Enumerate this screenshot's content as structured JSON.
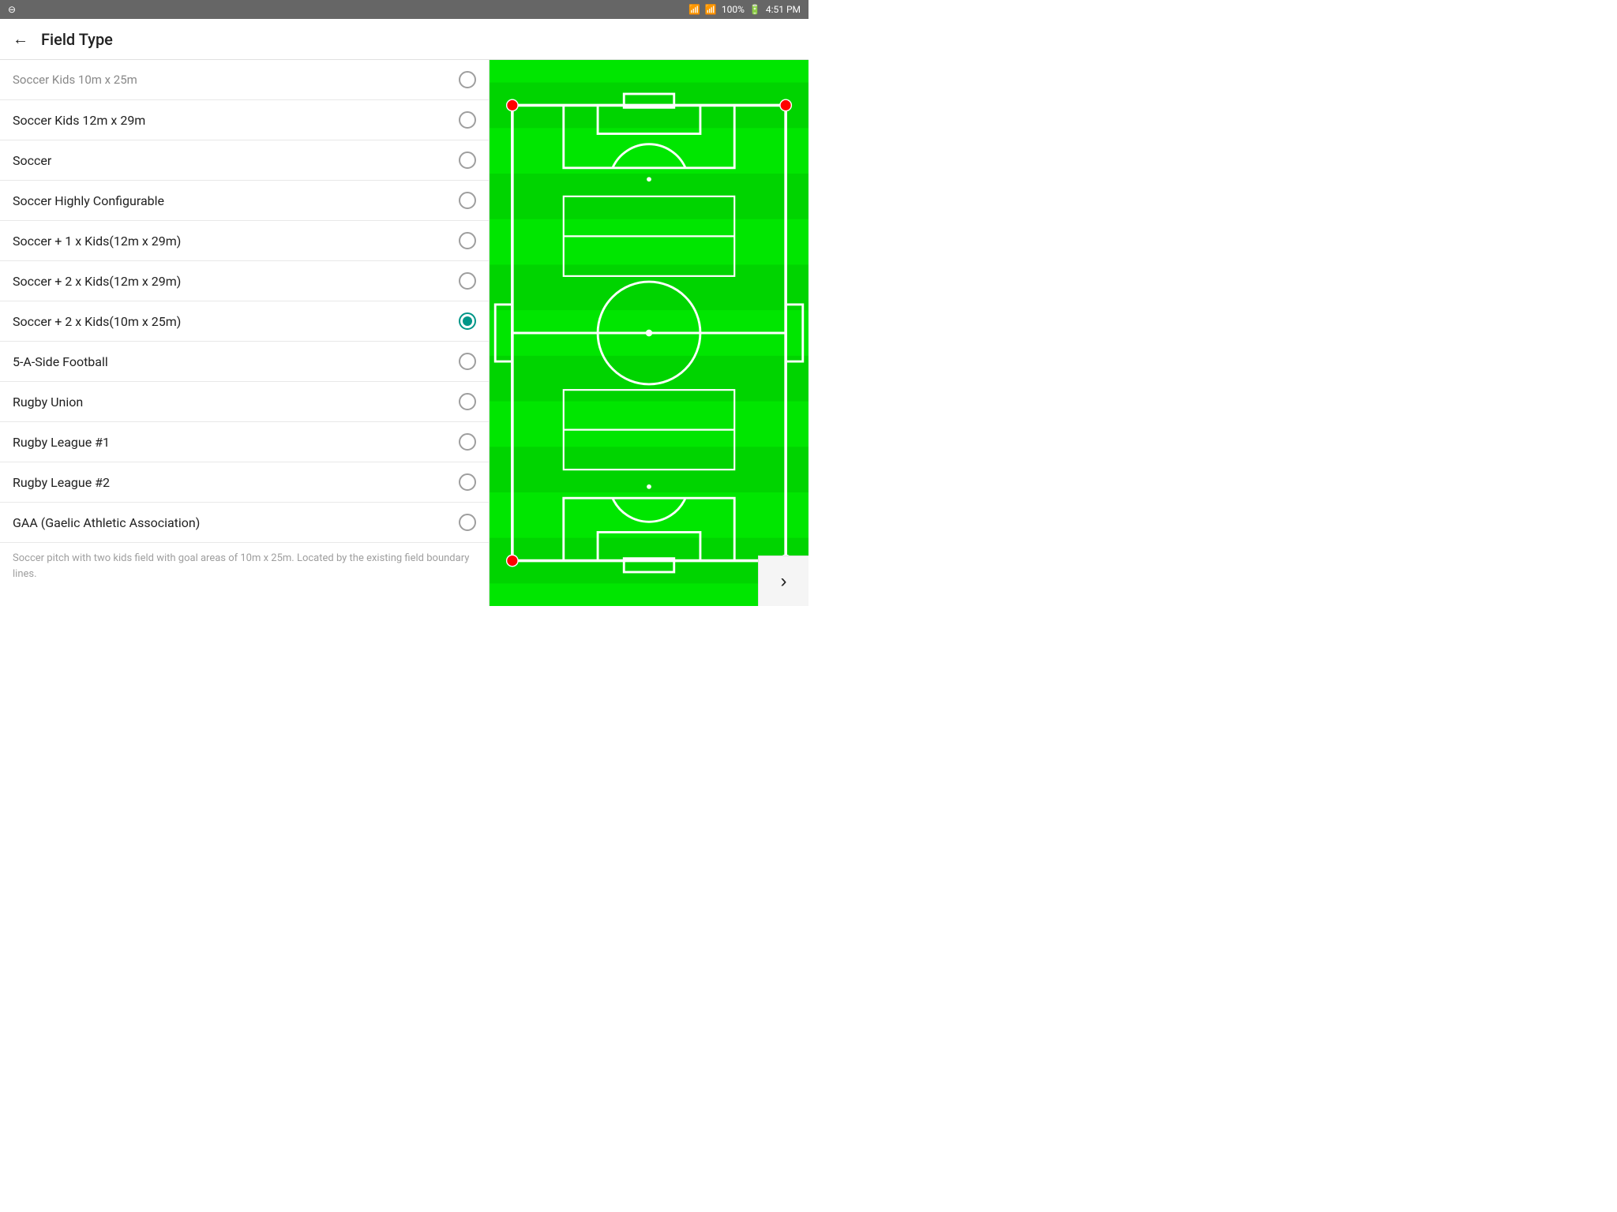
{
  "statusBar": {
    "left": "⊖",
    "battery": "100%",
    "time": "4:51 PM"
  },
  "header": {
    "title": "Field Type",
    "backLabel": "←"
  },
  "listItems": [
    {
      "id": "soccer-kids-10x25",
      "label": "Soccer Kids 10m x 25m",
      "selected": false,
      "truncated": true
    },
    {
      "id": "soccer-kids-12x29",
      "label": "Soccer Kids 12m x 29m",
      "selected": false,
      "truncated": false
    },
    {
      "id": "soccer",
      "label": "Soccer",
      "selected": false,
      "truncated": false
    },
    {
      "id": "soccer-highly-configurable",
      "label": "Soccer Highly Configurable",
      "selected": false,
      "truncated": false
    },
    {
      "id": "soccer-plus-1-kids-12x29",
      "label": "Soccer + 1 x Kids(12m x 29m)",
      "selected": false,
      "truncated": false
    },
    {
      "id": "soccer-plus-2-kids-12x29",
      "label": "Soccer + 2 x Kids(12m x 29m)",
      "selected": false,
      "truncated": false
    },
    {
      "id": "soccer-plus-2-kids-10x25",
      "label": "Soccer + 2 x Kids(10m x 25m)",
      "selected": true,
      "truncated": false
    },
    {
      "id": "5-a-side-football",
      "label": "5-A-Side Football",
      "selected": false,
      "truncated": false
    },
    {
      "id": "rugby-union",
      "label": "Rugby Union",
      "selected": false,
      "truncated": false
    },
    {
      "id": "rugby-league-1",
      "label": "Rugby League #1",
      "selected": false,
      "truncated": false
    },
    {
      "id": "rugby-league-2",
      "label": "Rugby League #2",
      "selected": false,
      "truncated": false
    },
    {
      "id": "gaa",
      "label": "GAA (Gaelic Athletic Association)",
      "selected": false,
      "truncated": false
    }
  ],
  "description": "Soccer pitch with two kids field with goal areas of 10m x 25m. Located by the existing field boundary lines.",
  "nextButton": {
    "label": "›"
  },
  "field": {
    "bgColor": "#00e600",
    "lineColor": "#ffffff",
    "cornerDotColor": "#ff0000"
  }
}
